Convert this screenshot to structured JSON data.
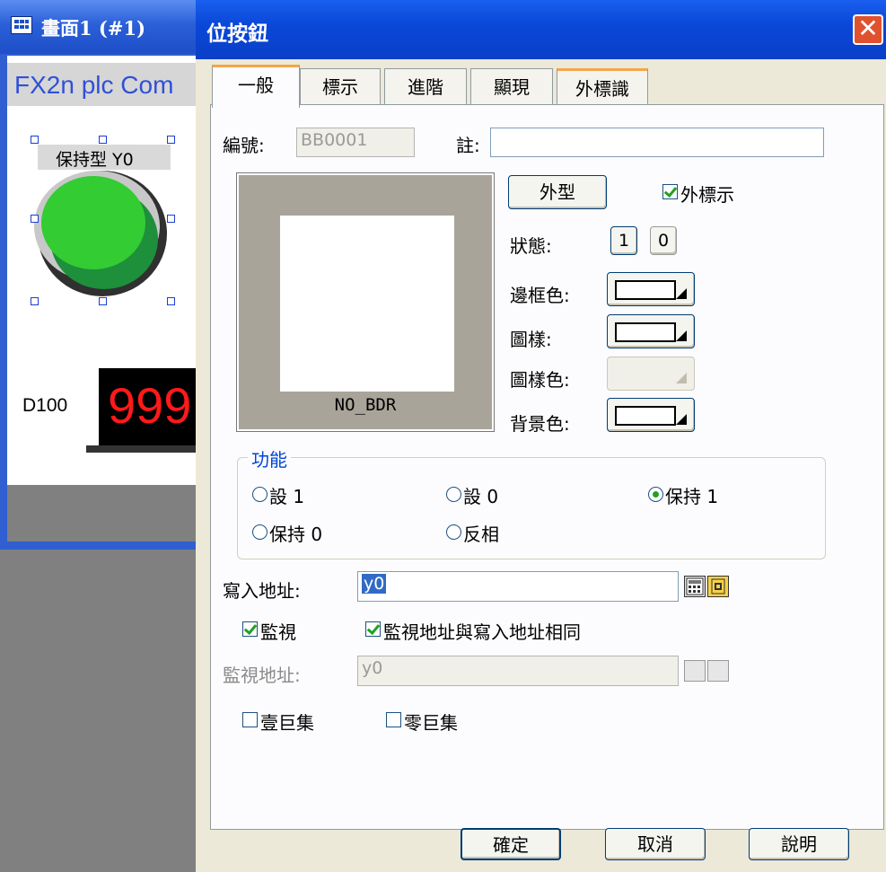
{
  "child_window": {
    "title": "畫面1 (#1)",
    "plc_text": "FX2n plc Com",
    "button_label": "保持型 Y0",
    "numeric_label": "D100",
    "numeric_value": "999"
  },
  "dialog": {
    "title": "位按鈕",
    "tabs": [
      "一般",
      "標示",
      "進階",
      "顯現",
      "外標識"
    ],
    "active_tab": 0,
    "id_label": "編號:",
    "id_value": "BB0001",
    "note_label": "註:",
    "note_value": "",
    "preview_caption": "NO_BDR",
    "shape_button": "外型",
    "ext_label_checkbox": "外標示",
    "state_label": "狀態:",
    "state_1": "1",
    "state_0": "0",
    "border_color_label": "邊框色:",
    "pattern_label": "圖樣:",
    "pattern_color_label": "圖樣色:",
    "bg_color_label": "背景色:",
    "function_group": "功能",
    "functions": {
      "set1": "設 1",
      "set0": "設 0",
      "hold1": "保持 1",
      "hold0": "保持 0",
      "invert": "反相"
    },
    "selected_function": "hold1",
    "write_addr_label": "寫入地址:",
    "write_addr_value": "y0",
    "monitor_checkbox": "監視",
    "same_addr_checkbox": "監視地址與寫入地址相同",
    "monitor_addr_label": "監視地址:",
    "monitor_addr_value": "y0",
    "macro1_checkbox": "壹巨集",
    "macro0_checkbox": "零巨集",
    "ok_button": "確定",
    "cancel_button": "取消",
    "help_button": "說明"
  },
  "colors": {
    "titlebar": "#0a48d8",
    "dialog_bg": "#ece9d8",
    "tab_accent": "#f5a54a",
    "button_green": "#33cc33",
    "segment_red": "#ff1a1a"
  }
}
